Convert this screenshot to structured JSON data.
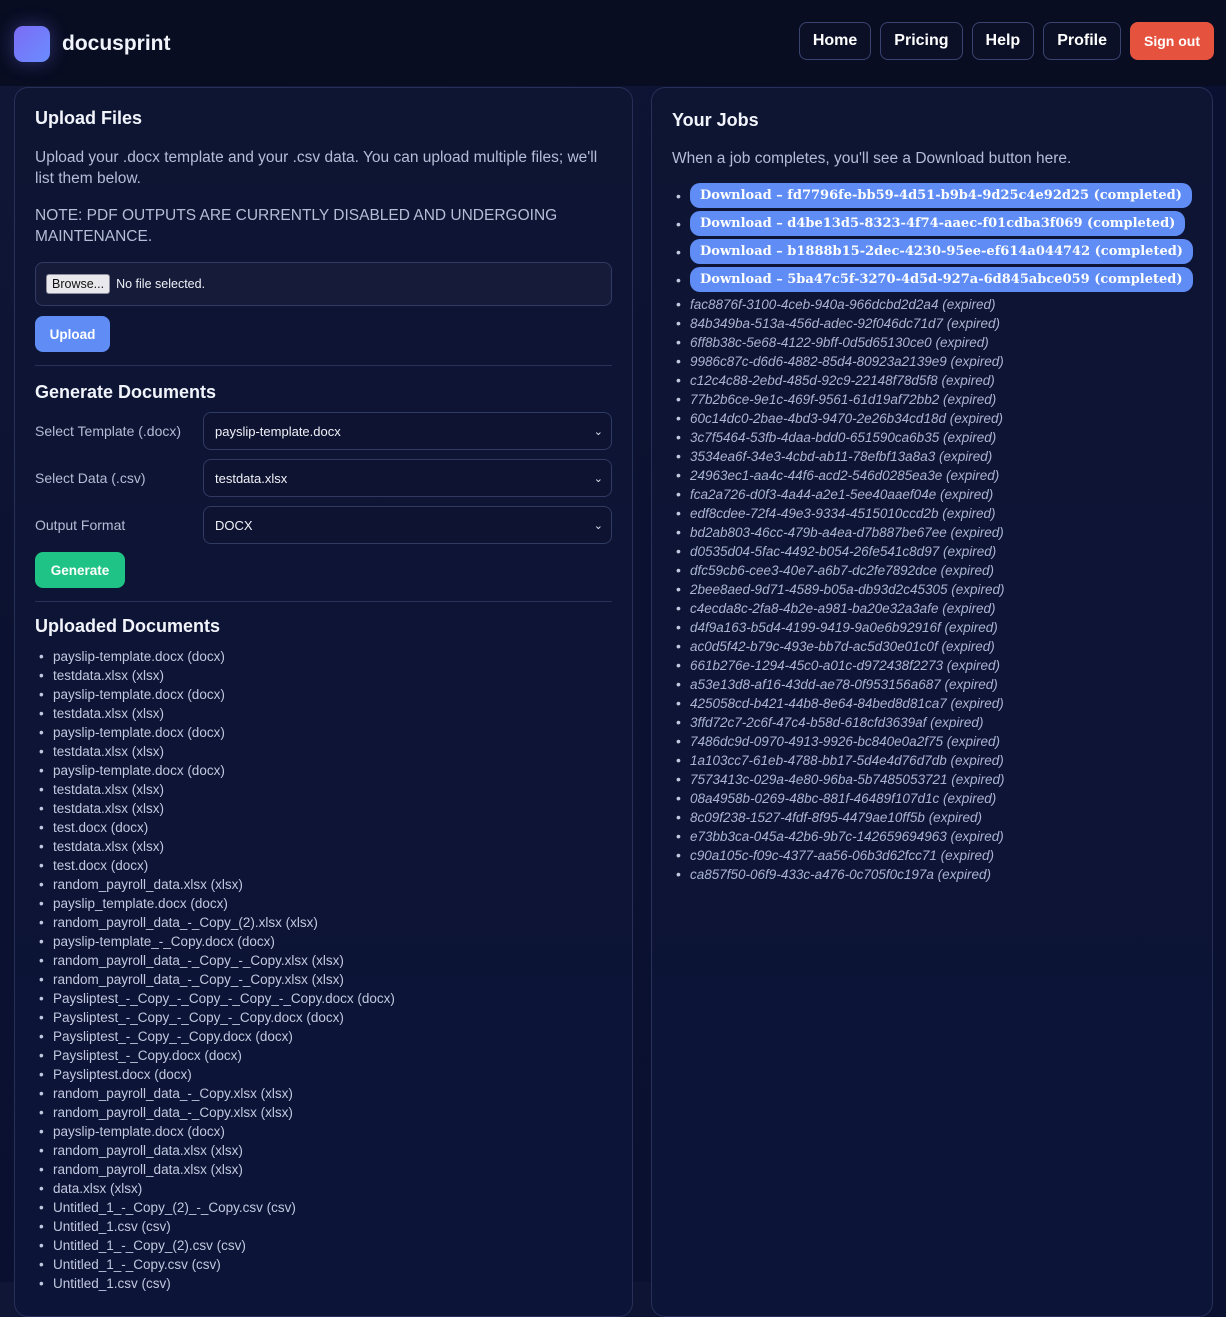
{
  "header": {
    "brand": "docusprint",
    "nav": {
      "home": "Home",
      "pricing": "Pricing",
      "help": "Help",
      "profile": "Profile",
      "signout": "Sign out"
    }
  },
  "upload": {
    "title": "Upload Files",
    "description": "Upload your .docx template and your .csv data. You can upload multiple files; we'll list them below.",
    "note": "NOTE: PDF OUTPUTS ARE CURRENTLY DISABLED AND UNDERGOING MAINTENANCE.",
    "browse_label": "Browse...",
    "file_status": "No file selected.",
    "upload_label": "Upload"
  },
  "generate": {
    "title": "Generate Documents",
    "template_label": "Select Template (.docx)",
    "template_value": "payslip-template.docx",
    "data_label": "Select Data (.csv)",
    "data_value": "testdata.xlsx",
    "format_label": "Output Format",
    "format_value": "DOCX",
    "generate_label": "Generate"
  },
  "uploaded": {
    "title": "Uploaded Documents",
    "items": [
      "payslip-template.docx (docx)",
      "testdata.xlsx (xlsx)",
      "payslip-template.docx (docx)",
      "testdata.xlsx (xlsx)",
      "payslip-template.docx (docx)",
      "testdata.xlsx (xlsx)",
      "payslip-template.docx (docx)",
      "testdata.xlsx (xlsx)",
      "testdata.xlsx (xlsx)",
      "test.docx (docx)",
      "testdata.xlsx (xlsx)",
      "test.docx (docx)",
      "random_payroll_data.xlsx (xlsx)",
      "payslip_template.docx (docx)",
      "random_payroll_data_-_Copy_(2).xlsx (xlsx)",
      "payslip-template_-_Copy.docx (docx)",
      "random_payroll_data_-_Copy_-_Copy.xlsx (xlsx)",
      "random_payroll_data_-_Copy_-_Copy.xlsx (xlsx)",
      "Paysliptest_-_Copy_-_Copy_-_Copy_-_Copy.docx (docx)",
      "Paysliptest_-_Copy_-_Copy_-_Copy.docx (docx)",
      "Paysliptest_-_Copy_-_Copy.docx (docx)",
      "Paysliptest_-_Copy.docx (docx)",
      "Paysliptest.docx (docx)",
      "random_payroll_data_-_Copy.xlsx (xlsx)",
      "random_payroll_data_-_Copy.xlsx (xlsx)",
      "payslip-template.docx (docx)",
      "random_payroll_data.xlsx (xlsx)",
      "random_payroll_data.xlsx (xlsx)",
      "data.xlsx (xlsx)",
      "Untitled_1_-_Copy_(2)_-_Copy.csv (csv)",
      "Untitled_1.csv (csv)",
      "Untitled_1_-_Copy_(2).csv (csv)",
      "Untitled_1_-_Copy.csv (csv)",
      "Untitled_1.csv (csv)"
    ]
  },
  "jobs": {
    "title": "Your Jobs",
    "description": "When a job completes, you'll see a Download button here.",
    "completed": [
      "Download – fd7796fe-bb59-4d51-b9b4-9d25c4e92d25 (completed)",
      "Download – d4be13d5-8323-4f74-aaec-f01cdba3f069 (completed)",
      "Download – b1888b15-2dec-4230-95ee-ef614a044742 (completed)",
      "Download – 5ba47c5f-3270-4d5d-927a-6d845abce059 (completed)"
    ],
    "expired": [
      "fac8876f-3100-4ceb-940a-966dcbd2d2a4 (expired)",
      "84b349ba-513a-456d-adec-92f046dc71d7 (expired)",
      "6ff8b38c-5e68-4122-9bff-0d5d65130ce0 (expired)",
      "9986c87c-d6d6-4882-85d4-80923a2139e9 (expired)",
      "c12c4c88-2ebd-485d-92c9-22148f78d5f8 (expired)",
      "77b2b6ce-9e1c-469f-9561-61d19af72bb2 (expired)",
      "60c14dc0-2bae-4bd3-9470-2e26b34cd18d (expired)",
      "3c7f5464-53fb-4daa-bdd0-651590ca6b35 (expired)",
      "3534ea6f-34e3-4cbd-ab11-78efbf13a8a3 (expired)",
      "24963ec1-aa4c-44f6-acd2-546d0285ea3e (expired)",
      "fca2a726-d0f3-4a44-a2e1-5ee40aaef04e (expired)",
      "edf8cdee-72f4-49e3-9334-4515010ccd2b (expired)",
      "bd2ab803-46cc-479b-a4ea-d7b887be67ee (expired)",
      "d0535d04-5fac-4492-b054-26fe541c8d97 (expired)",
      "dfc59cb6-cee3-40e7-a6b7-dc2fe7892dce (expired)",
      "2bee8aed-9d71-4589-b05a-db93d2c45305 (expired)",
      "c4ecda8c-2fa8-4b2e-a981-ba20e32a3afe (expired)",
      "d4f9a163-b5d4-4199-9419-9a0e6b92916f (expired)",
      "ac0d5f42-b79c-493e-bb7d-ac5d30e01c0f (expired)",
      "661b276e-1294-45c0-a01c-d972438f2273 (expired)",
      "a53e13d8-af16-43dd-ae78-0f953156a687 (expired)",
      "425058cd-b421-44b8-8e64-84bed8d81ca7 (expired)",
      "3ffd72c7-2c6f-47c4-b58d-618cfd3639af (expired)",
      "7486dc9d-0970-4913-9926-bc840e0a2f75 (expired)",
      "1a103cc7-61eb-4788-bb17-5d4e4d76d7db (expired)",
      "7573413c-029a-4e80-96ba-5b7485053721 (expired)",
      "08a4958b-0269-48bc-881f-46489f107d1c (expired)",
      "8c09f238-1527-4fdf-8f95-4479ae10ff5b (expired)",
      "e73bb3ca-045a-42b6-9b7c-142659694963 (expired)",
      "c90a105c-f09c-4377-aa56-06b3d62fcc71 (expired)",
      "ca857f50-06f9-433c-a476-0c705f0c197a (expired)"
    ]
  },
  "colors": {
    "background": "#0a1030",
    "accent_blue": "#5f8df5",
    "accent_green": "#1fc386",
    "signout_red": "#e5533f"
  },
  "icons": {
    "logo": "app-logo-icon",
    "select": "chevron-down-icon"
  }
}
